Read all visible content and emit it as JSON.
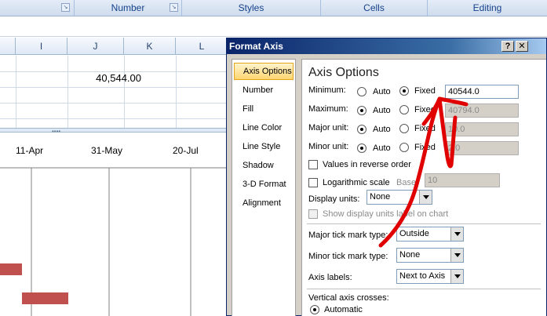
{
  "ribbon": {
    "groups": [
      "Number",
      "Styles",
      "Cells",
      "Editing"
    ]
  },
  "sheet": {
    "columns": [
      "I",
      "J",
      "K",
      "L"
    ],
    "cell_j1": "40,544.00"
  },
  "chart": {
    "axis_labels": [
      "11-Apr",
      "31-May",
      "20-Jul"
    ],
    "bar_color": "#c0504d"
  },
  "dialog": {
    "title": "Format Axis",
    "help_label": "?",
    "close_label": "✕",
    "sidebar": [
      "Axis Options",
      "Number",
      "Fill",
      "Line Color",
      "Line Style",
      "Shadow",
      "3-D Format",
      "Alignment"
    ],
    "panel_title": "Axis Options",
    "minimum": {
      "label": "Minimum:",
      "auto": "Auto",
      "fixed": "Fixed",
      "value": "40544.0"
    },
    "maximum": {
      "label": "Maximum:",
      "auto": "Auto",
      "fixed": "Fixed",
      "value": "40794.0"
    },
    "major": {
      "label": "Major unit:",
      "auto": "Auto",
      "fixed": "Fixed",
      "value": "10.0"
    },
    "minor": {
      "label": "Minor unit:",
      "auto": "Auto",
      "fixed": "Fixed",
      "value": "2.0"
    },
    "reverse_label": "Values in reverse order",
    "log_label": "Logarithmic scale",
    "base_label": "Base:",
    "base_value": "10",
    "display_units_label": "Display units:",
    "display_units_value": "None",
    "show_units_label": "Show display units label on chart",
    "major_tick_label": "Major tick mark type:",
    "major_tick_value": "Outside",
    "minor_tick_label": "Minor tick mark type:",
    "minor_tick_value": "None",
    "axis_labels_label": "Axis labels:",
    "axis_labels_value": "Next to Axis",
    "vaxis_label": "Vertical axis crosses:",
    "automatic_label": "Automatic"
  },
  "annotation": {
    "color": "#e00000"
  }
}
